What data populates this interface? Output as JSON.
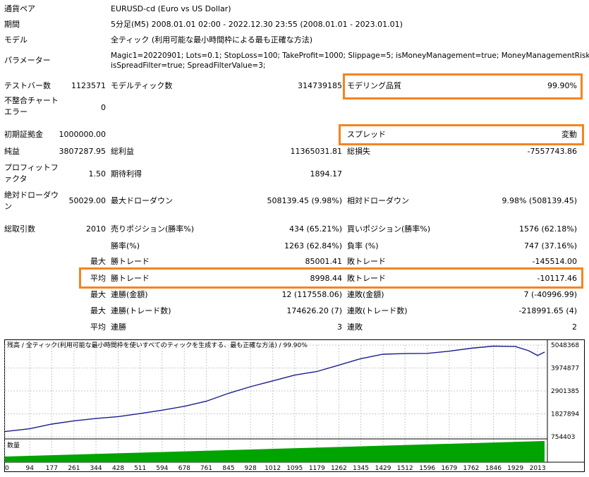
{
  "general": {
    "symbol_label": "通貨ペア",
    "symbol_value": "EURUSD-cd (Euro vs US Dollar)",
    "period_label": "期間",
    "period_value": "5分足(M5) 2008.01.01 02:00 - 2022.12.30 23:55 (2008.01.01 - 2023.01.01)",
    "model_label": "モデル",
    "model_value": "全ティック (利用可能な最小時間枠による最も正確な方法)",
    "params_label": "パラメーター",
    "params_line1": "Magic1=20220901; Lots=0.1; StopLoss=100; TakeProfit=1000; Slippage=5; isMoneyManagement=true; MoneyManagementRisk=3;",
    "params_line2": "isSpreadFilter=true; SpreadFilterValue=3;"
  },
  "stats": {
    "bars_label": "テストバー数",
    "bars_value": "1123571",
    "ticks_label": "モデルティック数",
    "ticks_value": "314739185",
    "quality_label": "モデリング品質",
    "quality_value": "99.90%",
    "mismatch_label_1": "不整合チャート",
    "mismatch_label_2": "エラー",
    "mismatch_value": "0",
    "deposit_label": "初期証拠金",
    "deposit_value": "1000000.00",
    "spread_label": "スプレッド",
    "spread_value": "変動",
    "net_label": "純益",
    "net_value": "3807287.95",
    "gross_profit_label": "総利益",
    "gross_profit_value": "11365031.81",
    "gross_loss_label": "総損失",
    "gross_loss_value": "-7557743.86",
    "pf_label_1": "プロフィットフ",
    "pf_label_2": "ァクタ",
    "pf_value": "1.50",
    "payoff_label": "期待利得",
    "payoff_value": "1894.17",
    "abs_dd_label_1": "絶対ドローダウ",
    "abs_dd_label_2": "ン",
    "abs_dd_value": "50029.00",
    "max_dd_label": "最大ドローダウン",
    "max_dd_value": "508139.45 (9.98%)",
    "rel_dd_label": "相対ドローダウン",
    "rel_dd_value": "9.98% (508139.45)",
    "trades_label": "総取引数",
    "trades_value": "2010",
    "short_label": "売りポジション(勝率%)",
    "short_value": "434 (65.21%)",
    "long_label": "買いポジション(勝率%)",
    "long_value": "1576 (62.18%)",
    "win_pct_label": "勝率(%)",
    "win_pct_value": "1263 (62.84%)",
    "loss_pct_label": "負率 (%)",
    "loss_pct_value": "747 (37.16%)",
    "max_prefix": "最大",
    "avg_prefix": "平均",
    "largest_win_label": "勝トレード",
    "largest_win_value": "85001.41",
    "largest_loss_label": "敗トレード",
    "largest_loss_value": "-145514.00",
    "avg_win_label": "勝トレード",
    "avg_win_value": "8998.44",
    "avg_loss_label": "敗トレード",
    "avg_loss_value": "-10117.46",
    "max_consec_win_label": "連勝(金額)",
    "max_consec_win_value": "12 (117558.06)",
    "max_consec_loss_label": "連敗(金額)",
    "max_consec_loss_value": "7 (-40996.99)",
    "max_consec_profit_label": "連勝(トレード数)",
    "max_consec_profit_value": "174626.20 (7)",
    "max_consec_lossamt_label": "連敗(トレード数)",
    "max_consec_lossamt_value": "-218991.65 (4)",
    "avg_consec_win_label": "連勝",
    "avg_consec_win_value": "3",
    "avg_consec_loss_label": "連敗",
    "avg_consec_loss_value": "2"
  },
  "chart_data": {
    "type": "line",
    "title": "残高 / 全ティック(利用可能な最小時間枠を使いすべてのティックを生成する、最も正確な方法) / 99.90%",
    "volume_label": "数量",
    "ylim": [
      754403,
      5048368
    ],
    "yticks": [
      "5048368",
      "3974877",
      "2901385",
      "1827894",
      "754403"
    ],
    "xlim": [
      0,
      2050
    ],
    "xticks": [
      0,
      94,
      177,
      261,
      344,
      428,
      511,
      594,
      678,
      761,
      845,
      928,
      1012,
      1095,
      1179,
      1262,
      1345,
      1429,
      1512,
      1596,
      1679,
      1762,
      1846,
      1929,
      2013
    ],
    "grid": true,
    "colors": {
      "balance": "#1c1c8f",
      "volume": "#00a400",
      "grid": "#c8c8c8"
    },
    "series": [
      {
        "x": [
          0,
          94,
          177,
          261,
          344,
          428,
          511,
          594,
          678,
          761,
          845,
          928,
          1012,
          1095,
          1179,
          1262,
          1345,
          1429,
          1512,
          1596,
          1679,
          1762,
          1846,
          1929,
          1980,
          2013,
          2040
        ],
        "values": [
          1000000,
          1130000,
          1350000,
          1500000,
          1610000,
          1700000,
          1840000,
          2000000,
          2180000,
          2420000,
          2790000,
          3100000,
          3370000,
          3640000,
          3810000,
          4110000,
          4410000,
          4620000,
          4650000,
          4660000,
          4760000,
          4900000,
          5000000,
          4980000,
          4780000,
          4560000,
          4720000
        ]
      }
    ]
  }
}
